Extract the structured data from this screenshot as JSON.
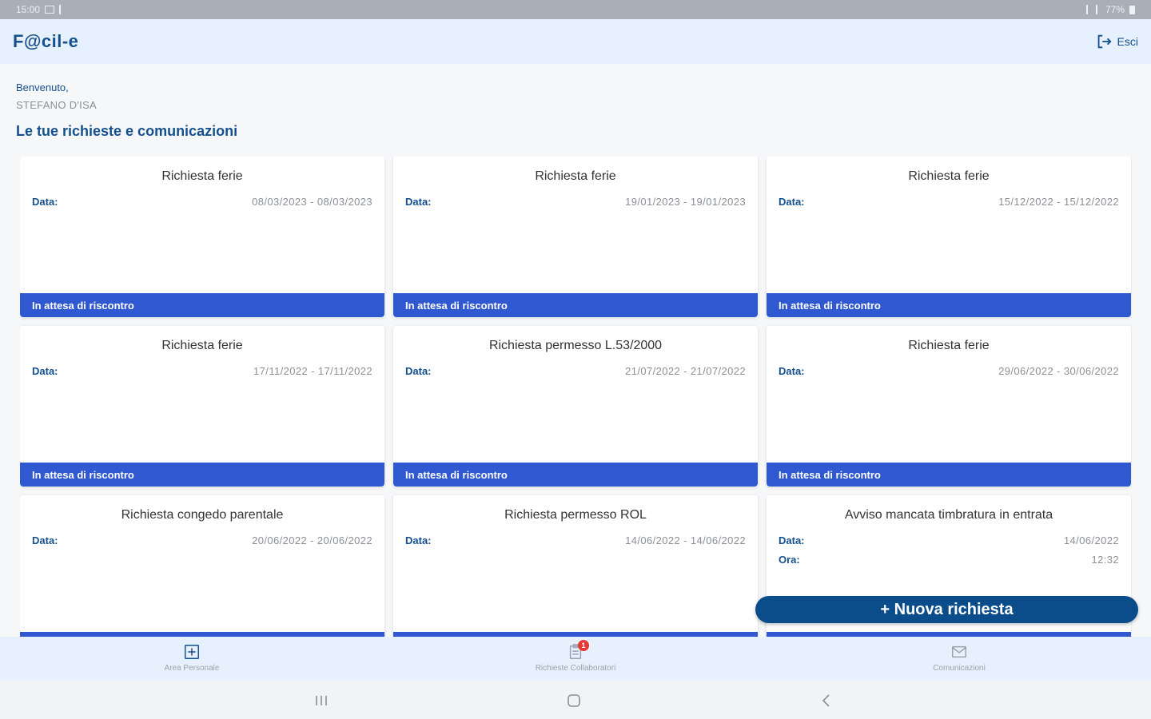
{
  "status_bar": {
    "time": "15:00",
    "battery": "77%"
  },
  "header": {
    "app_name": "F@cil-e",
    "exit_label": "Esci"
  },
  "welcome": {
    "greeting": "Benvenuto,",
    "user_name": "STEFANO D'ISA"
  },
  "section_title": "Le tue richieste e comunicazioni",
  "cards": [
    {
      "title": "Richiesta ferie",
      "rows": [
        {
          "label": "Data:",
          "value": "08/03/2023 - 08/03/2023"
        }
      ],
      "status": "In attesa di riscontro"
    },
    {
      "title": "Richiesta ferie",
      "rows": [
        {
          "label": "Data:",
          "value": "19/01/2023 - 19/01/2023"
        }
      ],
      "status": "In attesa di riscontro"
    },
    {
      "title": "Richiesta ferie",
      "rows": [
        {
          "label": "Data:",
          "value": "15/12/2022 - 15/12/2022"
        }
      ],
      "status": "In attesa di riscontro"
    },
    {
      "title": "Richiesta ferie",
      "rows": [
        {
          "label": "Data:",
          "value": "17/11/2022 - 17/11/2022"
        }
      ],
      "status": "In attesa di riscontro"
    },
    {
      "title": "Richiesta permesso L.53/2000",
      "rows": [
        {
          "label": "Data:",
          "value": "21/07/2022 - 21/07/2022"
        }
      ],
      "status": "In attesa di riscontro"
    },
    {
      "title": "Richiesta ferie",
      "rows": [
        {
          "label": "Data:",
          "value": "29/06/2022 - 30/06/2022"
        }
      ],
      "status": "In attesa di riscontro"
    },
    {
      "title": "Richiesta congedo parentale",
      "rows": [
        {
          "label": "Data:",
          "value": "20/06/2022 - 20/06/2022"
        }
      ],
      "status": ""
    },
    {
      "title": "Richiesta permesso ROL",
      "rows": [
        {
          "label": "Data:",
          "value": "14/06/2022 - 14/06/2022"
        }
      ],
      "status": ""
    },
    {
      "title": "Avviso mancata timbratura in entrata",
      "rows": [
        {
          "label": "Data:",
          "value": "14/06/2022"
        },
        {
          "label": "Ora:",
          "value": "12:32"
        }
      ],
      "status": ""
    }
  ],
  "fab_label": "+ Nuova richiesta",
  "bottom_nav": [
    {
      "label": "Area Personale",
      "icon": "add-box-icon",
      "badge": ""
    },
    {
      "label": "Richieste Collaboratori",
      "icon": "clipboard-icon",
      "badge": "1"
    },
    {
      "label": "Comunicazioni",
      "icon": "mail-icon",
      "badge": ""
    }
  ],
  "colors": {
    "primary": "#15508e",
    "status_strip": "#3059d1",
    "fab": "#0b4d8a",
    "header_bg": "#e7f1fd"
  }
}
